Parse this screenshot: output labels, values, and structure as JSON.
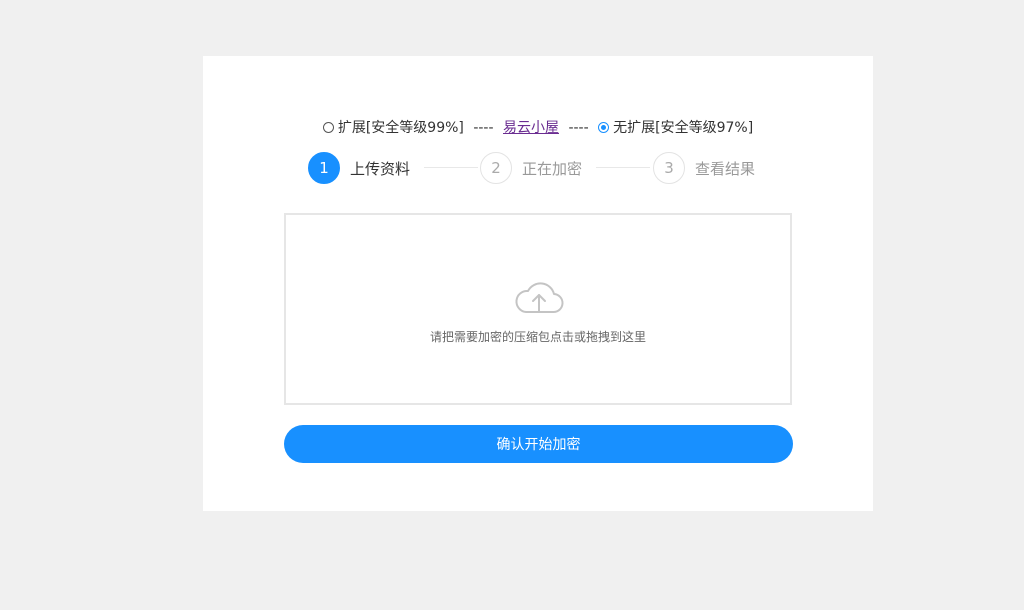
{
  "mode": {
    "option_extended": "扩展[安全等级99%]",
    "separator": "----",
    "link_text": "易云小屋",
    "option_no_extension": "无扩展[安全等级97%]",
    "selected": "no_extension"
  },
  "steps": [
    {
      "number": "1",
      "label": "上传资料",
      "active": true
    },
    {
      "number": "2",
      "label": "正在加密",
      "active": false
    },
    {
      "number": "3",
      "label": "查看结果",
      "active": false
    }
  ],
  "upload": {
    "icon": "cloud-upload-icon",
    "hint": "请把需要加密的压缩包点击或拖拽到这里"
  },
  "confirm_button": "确认开始加密",
  "colors": {
    "accent": "#1890ff",
    "link": "#6a2c91",
    "background": "#f0f0f0"
  }
}
